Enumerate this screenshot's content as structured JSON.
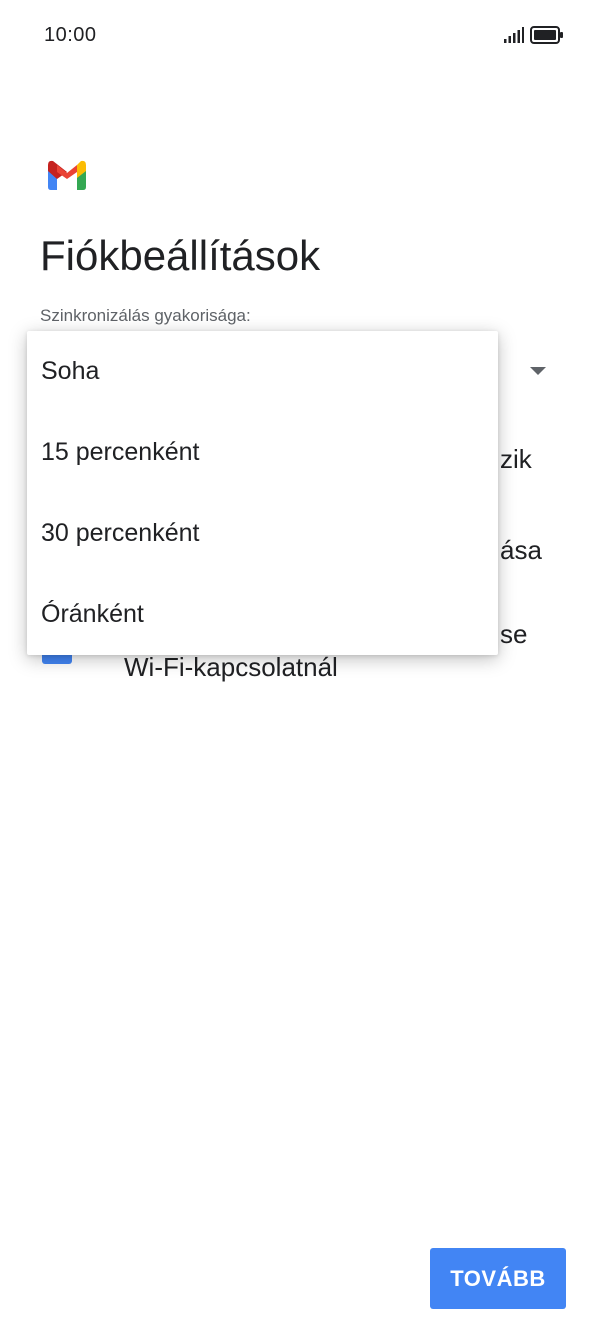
{
  "status_bar": {
    "time": "10:00",
    "signal_icon": "signal-bars-icon",
    "battery_icon": "battery-full-icon"
  },
  "logo": {
    "icon": "gmail-logo-icon",
    "colors": {
      "blue": "#4285f4",
      "red": "#ea4335",
      "yellow": "#fbbc04",
      "green": "#34a853"
    }
  },
  "page": {
    "title": "Fiókbeállítások"
  },
  "sync": {
    "label": "Szinkronizálás gyakorisága:",
    "options": [
      "Soha",
      "15 percenként",
      "30 percenként",
      "Óránként"
    ]
  },
  "background_fragments": {
    "line1": "zik",
    "line2": "ása",
    "line3": "se",
    "wifi_label": "Wi-Fi-kapcsolatnál"
  },
  "footer": {
    "next_label": "TOVÁBB"
  },
  "colors": {
    "accent": "#4285f4",
    "text_primary": "#202124",
    "text_secondary": "#5f6368"
  }
}
